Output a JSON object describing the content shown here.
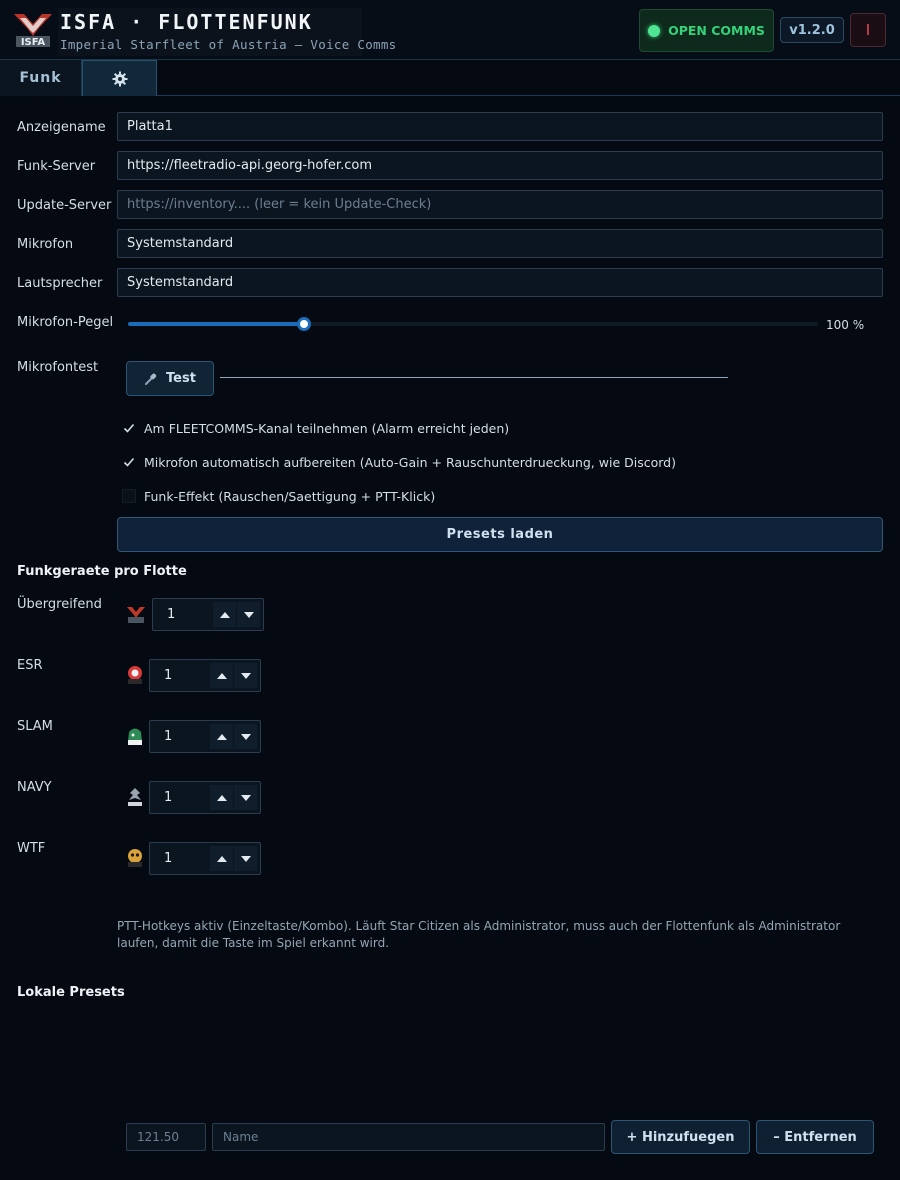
{
  "header": {
    "logo_text": "ISFA",
    "title": "ISFA · FLOTTENFUNK",
    "subtitle": "Imperial Starfleet of Austria — Voice Comms",
    "comms_button": "OPEN COMMS",
    "version": "v1.2.0",
    "close_label": "I"
  },
  "tabs": [
    {
      "label": "Funk",
      "active": false
    },
    {
      "label": "",
      "icon": "gear-icon",
      "active": true
    }
  ],
  "settings": {
    "display_name": {
      "label": "Anzeigename",
      "value": "Platta1"
    },
    "funk_server": {
      "label": "Funk-Server",
      "value": "https://fleetradio-api.georg-hofer.com"
    },
    "update_server": {
      "label": "Update-Server",
      "value": "",
      "placeholder": "https://inventory.... (leer = kein Update-Check)"
    },
    "microphone": {
      "label": "Mikrofon",
      "value": "Systemstandard"
    },
    "speaker": {
      "label": "Lautsprecher",
      "value": "Systemstandard"
    },
    "mic_level": {
      "label": "Mikrofon-Pegel",
      "value_text": "100 %",
      "fraction": 0.255
    },
    "mic_test": {
      "label": "Mikrofontest",
      "button": "Test"
    },
    "options": [
      {
        "label": "Am FLEETCOMMS-Kanal teilnehmen (Alarm erreicht jeden)",
        "checked": true
      },
      {
        "label": "Mikrofon automatisch aufbereiten (Auto-Gain + Rauschunterdrueckung, wie Discord)",
        "checked": true
      },
      {
        "label": "Funk-Effekt (Rauschen/Saettigung + PTT-Klick)",
        "checked": false
      }
    ],
    "presets_button": "Presets laden"
  },
  "fleets": {
    "title": "Funkgeraete pro Flotte",
    "items": [
      {
        "name": "Übergreifend",
        "value": "1",
        "icon": "isfa-fleet-icon",
        "color": "#c0392b"
      },
      {
        "name": "ESR",
        "value": "1",
        "icon": "esr-fleet-icon",
        "color": "#d63a3a"
      },
      {
        "name": "SLAM",
        "value": "1",
        "icon": "slam-fleet-icon",
        "color": "#2e8b57"
      },
      {
        "name": "NAVY",
        "value": "1",
        "icon": "navy-fleet-icon",
        "color": "#9aa4ae"
      },
      {
        "name": "WTF",
        "value": "1",
        "icon": "wtf-fleet-icon",
        "color": "#d9a23a"
      }
    ]
  },
  "hint": "PTT-Hotkeys aktiv (Einzeltaste/Kombo). Läuft Star Citizen als Administrator, muss auch der Flottenfunk als Administrator laufen, damit die Taste im Spiel erkannt wird.",
  "local_presets": {
    "title": "Lokale Presets",
    "freq_placeholder": "121.50",
    "name_placeholder": "Name",
    "add_button": "+ Hinzufuegen",
    "remove_button": "– Entfernen"
  },
  "colors": {
    "accent": "#1b6cb9",
    "comms_green": "#35d27a",
    "close_red": "#e44a5c",
    "brand_red": "#c0392b"
  }
}
